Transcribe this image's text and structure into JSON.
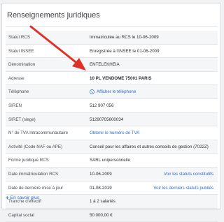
{
  "section_title": "Renseignements juridiques",
  "rows": [
    {
      "label": "Statut RCS",
      "value": "Immatriculée au RCS le 10-06-2009"
    },
    {
      "label": "Statut INSEE",
      "value": "Enregistrée à l'INSEE le 01-06-2009"
    },
    {
      "label": "Dénomination",
      "value": "ENTELEKHEIA"
    },
    {
      "label": "Adresse",
      "value": "10 PL VENDOME 75001 PARIS"
    },
    {
      "label": "Téléphone",
      "value": "Afficher le téléphone"
    },
    {
      "label": "SIREN",
      "value": "512 907 056"
    },
    {
      "label": "SIRET (siege)",
      "value": "51290705600034"
    },
    {
      "label": "N° de TVA Intracommunautaire",
      "value": "Obtenir le numéro de TVA"
    },
    {
      "label": "Activité (Code NAF ou APE)",
      "value": "Conseil pour les affaires et autres conseils de gestion (7022Z)"
    },
    {
      "label": "Forme juridique RCS",
      "value": "SARL unipersonnelle"
    },
    {
      "label": "Date immatriculation RCS",
      "value": "10-06-2009",
      "link": "Voir les statuts constitutifs"
    },
    {
      "label": "Date de dernière mise à jour",
      "value": "01-08-2019",
      "link": "Voir les derniers statuts publiés"
    },
    {
      "label": "Tranche d'effectif",
      "value": "1 à 2 salariés"
    },
    {
      "label": "Capital social",
      "value": "50 000,00 €"
    }
  ],
  "more_link": "En savoir plus",
  "colors": {
    "link": "#2b6bd1",
    "arrow": "#e0302a"
  },
  "icons": {
    "phone": "phone-icon",
    "more": "plus-icon"
  }
}
